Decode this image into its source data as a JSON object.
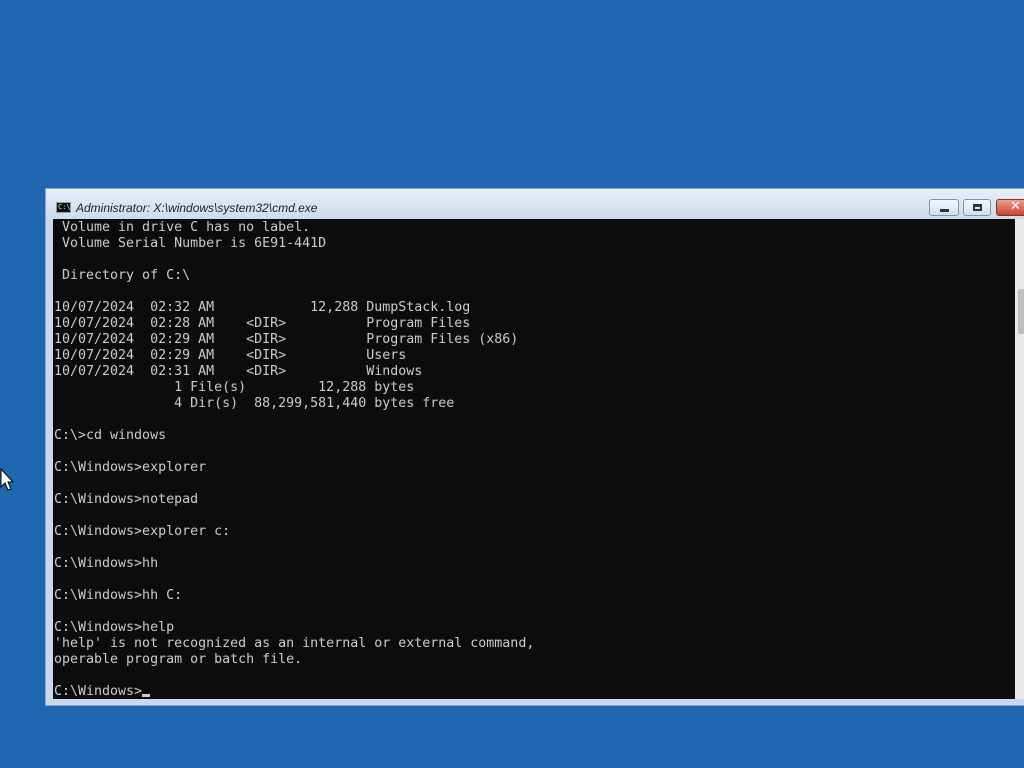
{
  "window": {
    "title": "Administrator: X:\\windows\\system32\\cmd.exe",
    "icon_label": "C:\\",
    "icon": "console-icon",
    "buttons": {
      "minimize": "minimize-icon",
      "maximize": "maximize-icon",
      "close_glyph": "✕"
    }
  },
  "console": {
    "lines": [
      " Volume in drive C has no label.",
      " Volume Serial Number is 6E91-441D",
      "",
      " Directory of C:\\",
      "",
      "10/07/2024  02:32 AM            12,288 DumpStack.log",
      "10/07/2024  02:28 AM    <DIR>          Program Files",
      "10/07/2024  02:29 AM    <DIR>          Program Files (x86)",
      "10/07/2024  02:29 AM    <DIR>          Users",
      "10/07/2024  02:31 AM    <DIR>          Windows",
      "               1 File(s)         12,288 bytes",
      "               4 Dir(s)  88,299,581,440 bytes free",
      "",
      "C:\\>cd windows",
      "",
      "C:\\Windows>explorer",
      "",
      "C:\\Windows>notepad",
      "",
      "C:\\Windows>explorer c:",
      "",
      "C:\\Windows>hh",
      "",
      "C:\\Windows>hh C:",
      "",
      "C:\\Windows>help",
      "'help' is not recognized as an internal or external command,",
      "operable program or batch file.",
      ""
    ],
    "prompt": "C:\\Windows>"
  },
  "colors": {
    "desktop": "#1f67b1",
    "console_bg": "#0c0c0c",
    "console_text": "#cccccc",
    "close_button": "#c54632"
  },
  "pointer": "mouse-pointer-icon"
}
